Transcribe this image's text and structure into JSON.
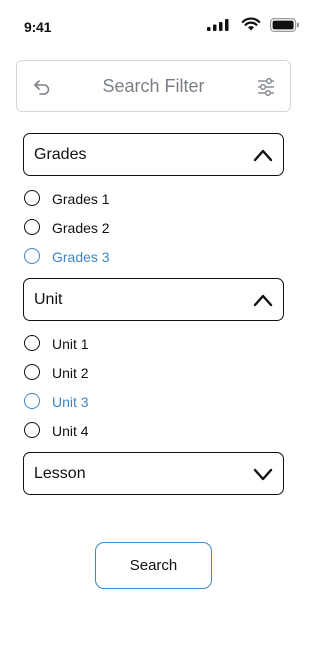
{
  "status_bar": {
    "time": "9:41",
    "icons": [
      "cellular-signal-icon",
      "wifi-icon",
      "battery-icon"
    ]
  },
  "search_bar": {
    "title": "Search Filter",
    "left_icon": "back-icon",
    "right_icon": "filter-sliders-icon"
  },
  "sections": {
    "grades": {
      "label": "Grades",
      "expanded": true,
      "options": [
        "Grades 1",
        "Grades 2",
        "Grades 3"
      ],
      "selected": "Grades 3"
    },
    "unit": {
      "label": "Unit",
      "expanded": true,
      "options": [
        "Unit 1",
        "Unit 2",
        "Unit 3",
        "Unit 4"
      ],
      "selected": "Unit 3"
    },
    "lesson": {
      "label": "Lesson",
      "expanded": false
    }
  },
  "search_button": {
    "label": "Search"
  },
  "colors": {
    "accent": "#3b87c9",
    "text": "#111111",
    "muted": "#7a7f87",
    "border": "#d6d6d6"
  }
}
